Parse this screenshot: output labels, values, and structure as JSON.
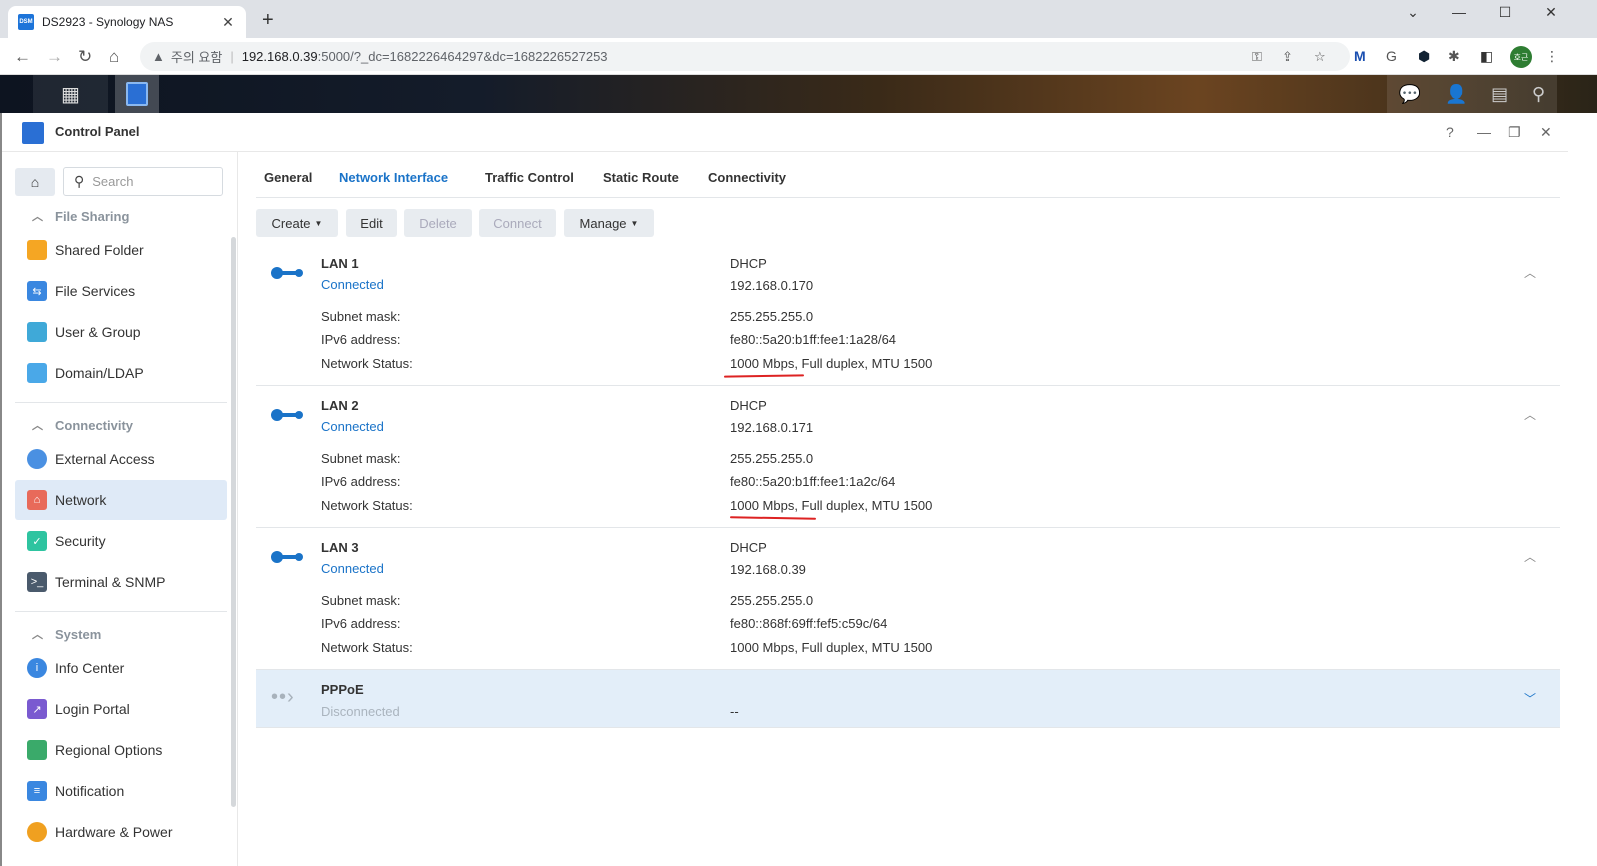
{
  "browser": {
    "tab_title": "DS2923 - Synology NAS",
    "tab_fav": "DSM",
    "tab_close": "✕",
    "new_tab": "+",
    "security_warning": "주의 요함",
    "url_host": "192.168.0.39",
    "url_rest": ":5000/?_dc=1682226464297&dc=1682226527253",
    "profile": "호근"
  },
  "window": {
    "title": "Control Panel"
  },
  "sidebar": {
    "search_placeholder": "Search",
    "sections": [
      {
        "title": "File Sharing",
        "items": [
          "Shared Folder",
          "File Services",
          "User & Group",
          "Domain/LDAP"
        ]
      },
      {
        "title": "Connectivity",
        "items": [
          "External Access",
          "Network",
          "Security",
          "Terminal & SNMP"
        ]
      },
      {
        "title": "System",
        "items": [
          "Info Center",
          "Login Portal",
          "Regional Options",
          "Notification",
          "Hardware & Power"
        ]
      }
    ],
    "active_item": "Network"
  },
  "tabs": [
    "General",
    "Network Interface",
    "Traffic Control",
    "Static Route",
    "Connectivity"
  ],
  "active_tab": "Network Interface",
  "toolbar": {
    "create": "Create",
    "edit": "Edit",
    "delete": "Delete",
    "connect": "Connect",
    "manage": "Manage"
  },
  "labels": {
    "subnet": "Subnet mask:",
    "ipv6": "IPv6 address:",
    "status": "Network Status:"
  },
  "interfaces": [
    {
      "name": "LAN 1",
      "status": "Connected",
      "mode": "DHCP",
      "ip": "192.168.0.170",
      "subnet": "255.255.255.0",
      "ipv6": "fe80::5a20:b1ff:fee1:1a28/64",
      "net_status": "1000 Mbps, Full duplex, MTU 1500"
    },
    {
      "name": "LAN 2",
      "status": "Connected",
      "mode": "DHCP",
      "ip": "192.168.0.171",
      "subnet": "255.255.255.0",
      "ipv6": "fe80::5a20:b1ff:fee1:1a2c/64",
      "net_status": "1000 Mbps, Full duplex, MTU 1500"
    },
    {
      "name": "LAN 3",
      "status": "Connected",
      "mode": "DHCP",
      "ip": "192.168.0.39",
      "subnet": "255.255.255.0",
      "ipv6": "fe80::868f:69ff:fef5:c59c/64",
      "net_status": "1000 Mbps, Full duplex, MTU 1500"
    }
  ],
  "pppoe": {
    "name": "PPPoE",
    "status": "Disconnected",
    "value": "--"
  },
  "colors": {
    "accent": "#1a73c8",
    "annotation": "#dd2222"
  }
}
